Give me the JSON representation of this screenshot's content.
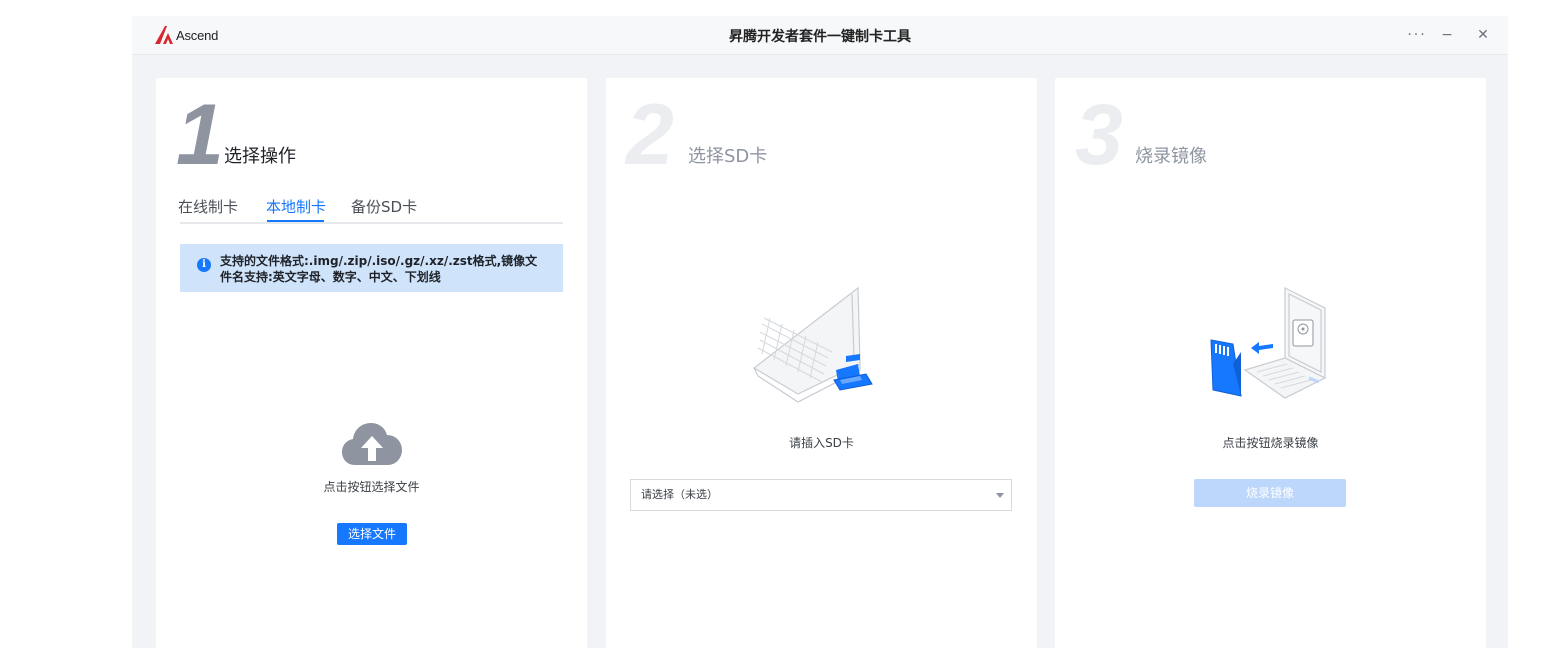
{
  "window": {
    "brand": "Ascend",
    "title": "昇腾开发者套件一键制卡工具",
    "more_label": "···",
    "minimize_label": "−",
    "close_label": "✕"
  },
  "step1": {
    "number": "1",
    "title": "选择操作",
    "tabs": [
      {
        "label": "在线制卡",
        "active": false
      },
      {
        "label": "本地制卡",
        "active": true
      },
      {
        "label": "备份SD卡",
        "active": false
      }
    ],
    "notice": "支持的文件格式:.img/.zip/.iso/.gz/.xz/.zst格式,镜像文件名支持:英文字母、数字、中文、下划线",
    "hint": "点击按钮选择文件",
    "button_label": "选择文件"
  },
  "step2": {
    "number": "2",
    "title": "选择SD卡",
    "hint": "请插入SD卡",
    "select_value": "请选择（未选）"
  },
  "step3": {
    "number": "3",
    "title": "烧录镜像",
    "hint": "点击按钮烧录镜像",
    "button_label": "烧录镜像"
  },
  "colors": {
    "accent": "#1677ff",
    "accent_disabled": "#bcd7fb",
    "notice_bg": "#cfe3fb",
    "brand_red": "#d7282f"
  },
  "icons": {
    "upload": "cloud-upload-icon",
    "info": "info-icon",
    "sd": "laptop-sd-card-illustration",
    "burn": "laptop-burn-image-illustration"
  }
}
